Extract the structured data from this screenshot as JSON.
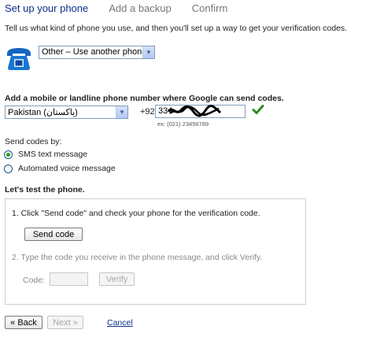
{
  "steps": [
    {
      "label": "Set up your phone",
      "active": true
    },
    {
      "label": "Add a backup",
      "active": false
    },
    {
      "label": "Confirm",
      "active": false
    }
  ],
  "intro": "Tell us what kind of phone you use, and then you'll set up a way to get your verification codes.",
  "phone_type": {
    "selected": "Other – Use another phone"
  },
  "number_section": {
    "label": "Add a mobile or landline phone number where Google can send codes.",
    "country": "Pakistan (پاکستان)",
    "prefix": "+92",
    "number_value": "334",
    "example": "ex: (021) 23456789"
  },
  "send_codes": {
    "label": "Send codes by:",
    "options": [
      {
        "label": "SMS text message",
        "checked": true
      },
      {
        "label": "Automated voice message",
        "checked": false
      }
    ]
  },
  "test": {
    "label": "Let's test the phone.",
    "step1": "1.  Click \"Send code\" and check your phone for the verification code.",
    "send_button": "Send code",
    "step2": "2.  Type the code you receive in the phone message, and click Verify.",
    "code_label": "Code:",
    "verify_button": "Verify"
  },
  "nav": {
    "back": "« Back",
    "next": "Next »",
    "cancel": "Cancel"
  },
  "colors": {
    "active_step": "#0b2f8f",
    "phone_icon": "#1565c0",
    "check": "#2e8b22"
  }
}
